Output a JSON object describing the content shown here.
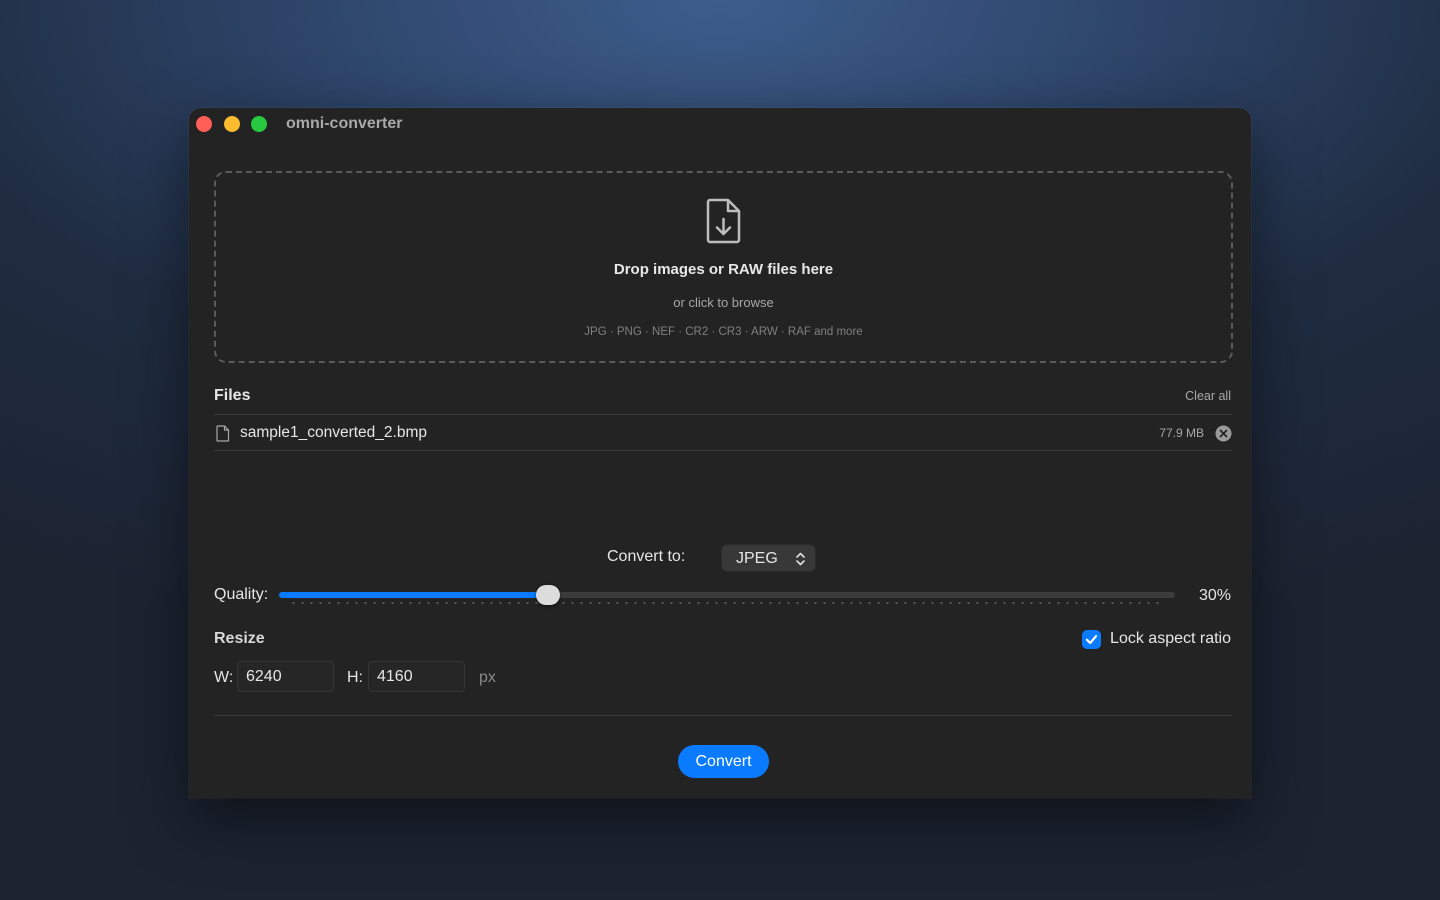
{
  "window": {
    "title": "omni-converter"
  },
  "dropzone": {
    "icon": "file-download-icon",
    "title": "Drop images or RAW files here",
    "subtitle": "or click to browse",
    "formats": "JPG · PNG · NEF · CR2 · CR3 · ARW · RAF and more"
  },
  "files": {
    "header": "Files",
    "clear_all": "Clear all",
    "items": [
      {
        "name": "sample1_converted_2.bmp",
        "size": "77.9 MB",
        "icon": "file-icon"
      }
    ]
  },
  "convert_to": {
    "label": "Convert to:",
    "selected": "JPEG"
  },
  "quality": {
    "label": "Quality:",
    "value": 30,
    "value_text": "30%"
  },
  "resize": {
    "label": "Resize",
    "lock_aspect_label": "Lock aspect ratio",
    "lock_aspect_checked": true,
    "width_label": "W:",
    "width_value": "6240",
    "height_label": "H:",
    "height_value": "4160",
    "unit": "px"
  },
  "actions": {
    "convert_label": "Convert"
  },
  "colors": {
    "accent": "#0a7bff",
    "window_bg": "#232323",
    "close": "#ff5f57",
    "minimize": "#febc2e",
    "maximize": "#28c840"
  }
}
